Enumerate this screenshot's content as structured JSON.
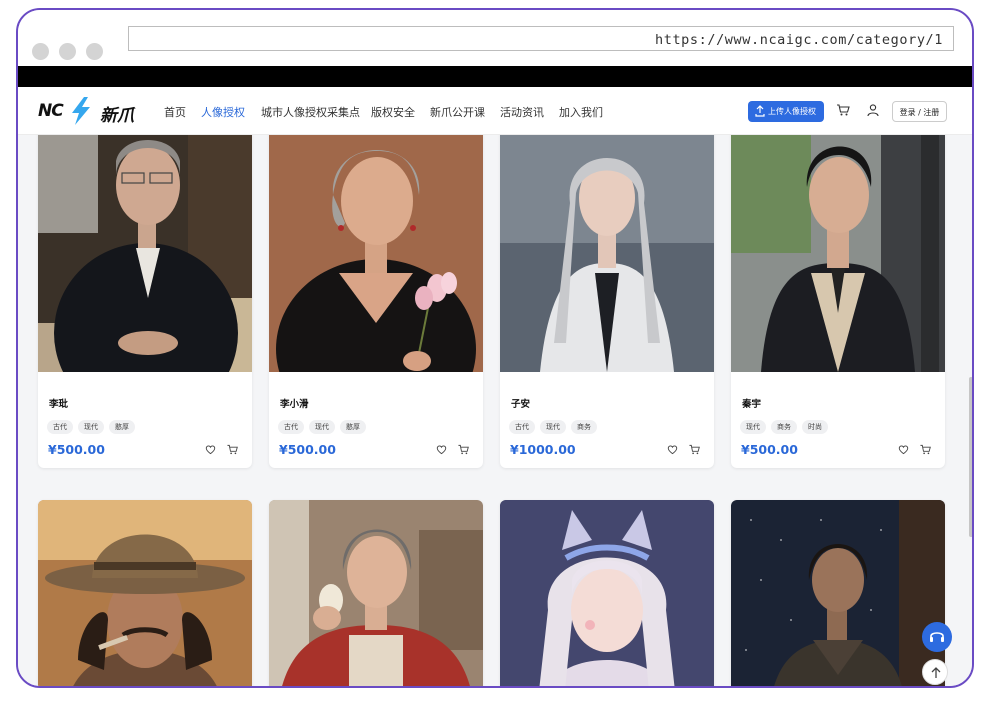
{
  "browser": {
    "url": "https://www.ncaigc.com/category/1"
  },
  "logo": {
    "mark": "NC",
    "name": "新爪"
  },
  "nav": {
    "items": [
      {
        "label": "首页",
        "active": false
      },
      {
        "label": "人像授权",
        "active": true
      },
      {
        "label": "城市人像授权采集点",
        "active": false
      },
      {
        "label": "版权安全",
        "active": false
      },
      {
        "label": "新爪公开课",
        "active": false
      },
      {
        "label": "活动资讯",
        "active": false
      },
      {
        "label": "加入我们",
        "active": false
      }
    ],
    "upload_label": "上传人像授权",
    "login_label": "登录 / 注册"
  },
  "colors": {
    "accent": "#2a68d8",
    "button": "#2d6be0",
    "frame": "#6a4bc4"
  },
  "cards": [
    {
      "name": "李玭",
      "tags": [
        "古代",
        "现代",
        "憨厚"
      ],
      "price": "¥500.00"
    },
    {
      "name": "李小滑",
      "tags": [
        "古代",
        "现代",
        "憨厚"
      ],
      "price": "¥500.00"
    },
    {
      "name": "子安",
      "tags": [
        "古代",
        "现代",
        "商务"
      ],
      "price": "¥1000.00"
    },
    {
      "name": "秦宇",
      "tags": [
        "现代",
        "商务",
        "时尚"
      ],
      "price": "¥500.00"
    },
    {
      "name": "",
      "tags": [],
      "price": ""
    },
    {
      "name": "",
      "tags": [],
      "price": ""
    },
    {
      "name": "",
      "tags": [],
      "price": ""
    },
    {
      "name": "",
      "tags": [],
      "price": ""
    }
  ]
}
